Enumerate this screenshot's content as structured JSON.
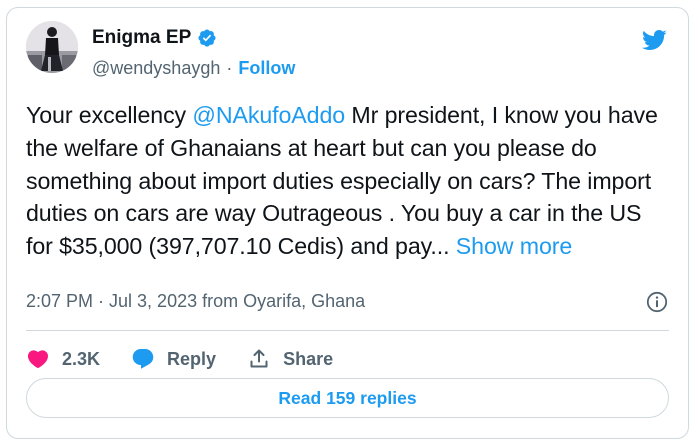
{
  "author": {
    "name": "Enigma EP",
    "handle": "@wendyshaygh",
    "separator": "·",
    "follow_label": "Follow"
  },
  "tweet": {
    "text_before_mention": "Your excellency ",
    "mention": "@NAkufoAddo",
    "text_after_mention": "  Mr president, I know you have the welfare of Ghanaians at heart but can you please do something about import duties especially on cars? The import duties on cars are way Outrageous . You buy a car in the US for $35,000 (397,707.10 Cedis) and pay... ",
    "show_more_label": "Show more",
    "timestamp": "2:07 PM · Jul 3, 2023 from Oyarifa, Ghana"
  },
  "actions": {
    "like_count": "2.3K",
    "reply_label": "Reply",
    "share_label": "Share"
  },
  "read_replies_label": "Read 159 replies",
  "colors": {
    "accent": "#1d9bf0",
    "like": "#f91880",
    "text": "#0f1419",
    "secondary": "#536471",
    "border": "#cfd9de"
  },
  "icons": [
    "verified-badge-icon",
    "twitter-bird-icon",
    "info-icon",
    "heart-icon",
    "reply-bubble-icon",
    "share-icon"
  ]
}
